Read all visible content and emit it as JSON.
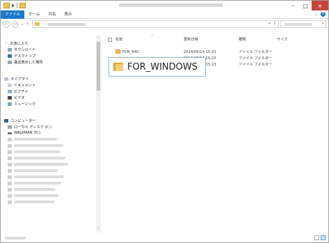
{
  "ribbon": {
    "tabs": [
      "ファイル",
      "ホーム",
      "共有",
      "表示"
    ]
  },
  "window": {
    "controls": [
      "–",
      "□",
      "×"
    ]
  },
  "addressbar": {
    "refresh_label": "C",
    "dropdown_label": "v"
  },
  "nav": {
    "quick_access": [
      {
        "label": "お気に入り"
      },
      {
        "label": "ダウンロード"
      },
      {
        "label": "デスクトップ"
      },
      {
        "label": "最近表示した場所"
      }
    ],
    "libraries": [
      {
        "label": "ライブラリ"
      },
      {
        "label": "ドキュメント"
      },
      {
        "label": "ピクチャ"
      },
      {
        "label": "ビデオ"
      },
      {
        "label": "ミュージック"
      }
    ],
    "computer": [
      {
        "label": "コンピューター"
      },
      {
        "label": "ローカル ディスク (C:)"
      },
      {
        "label": "WALKMAN (D:)"
      }
    ]
  },
  "columns": {
    "name": "名前",
    "date": "更新日時",
    "type": "種類",
    "size": "サイズ"
  },
  "files": [
    {
      "name": "FOR_MAC",
      "date": "2014/05/14 15:23",
      "type": "ファイル フォルダー"
    },
    {
      "name": "FOR_WINDOWS",
      "date": "2014/05/14 15:23",
      "type": "ファイル フォルダー"
    },
    {
      "name": "",
      "date": "2014/05/14 15:23",
      "type": "ファイル フォルダー"
    }
  ],
  "highlight": {
    "label": "FOR_WINDOWS"
  }
}
